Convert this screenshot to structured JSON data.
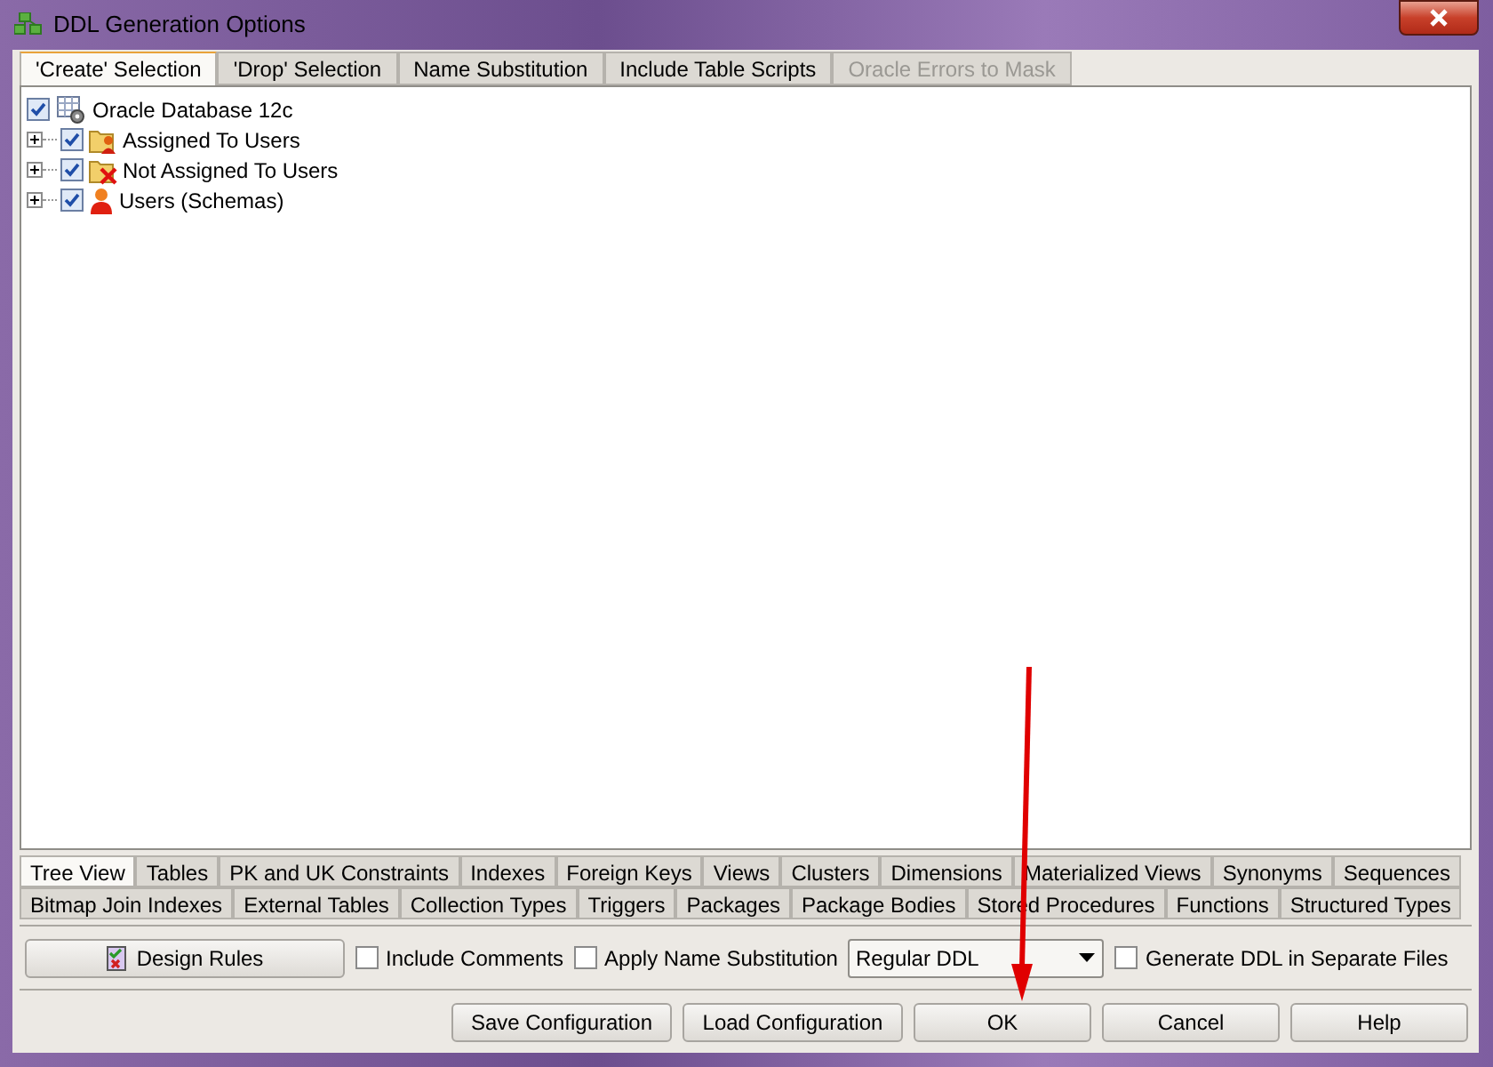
{
  "window": {
    "title": "DDL Generation Options"
  },
  "top_tabs": [
    {
      "label": "'Create' Selection",
      "selected": true,
      "disabled": false
    },
    {
      "label": "'Drop' Selection",
      "selected": false,
      "disabled": false
    },
    {
      "label": "Name Substitution",
      "selected": false,
      "disabled": false
    },
    {
      "label": "Include Table Scripts",
      "selected": false,
      "disabled": false
    },
    {
      "label": "Oracle Errors to Mask",
      "selected": false,
      "disabled": true
    }
  ],
  "tree": {
    "label": "Oracle Database 12c",
    "checked": true,
    "kind": "database",
    "children": [
      {
        "label": "Assigned To Users",
        "checked": true,
        "expanded": false,
        "kind": "user-folder"
      },
      {
        "label": "Not Assigned To Users",
        "checked": true,
        "expanded": false,
        "kind": "excluded-folder"
      },
      {
        "label": "Users (Schemas)",
        "checked": true,
        "expanded": false,
        "kind": "user"
      }
    ]
  },
  "object_tabs": [
    {
      "tabs": [
        {
          "label": "Tree View",
          "selected": true
        },
        {
          "label": "Tables",
          "selected": false
        },
        {
          "label": "PK and UK Constraints",
          "selected": false
        },
        {
          "label": "Indexes",
          "selected": false
        },
        {
          "label": "Foreign Keys",
          "selected": false
        },
        {
          "label": "Views",
          "selected": false
        },
        {
          "label": "Clusters",
          "selected": false
        },
        {
          "label": "Dimensions",
          "selected": false
        },
        {
          "label": "Materialized Views",
          "selected": false
        },
        {
          "label": "Synonyms",
          "selected": false
        },
        {
          "label": "Sequences",
          "selected": false
        }
      ]
    },
    {
      "tabs": [
        {
          "label": "Bitmap Join Indexes",
          "selected": false
        },
        {
          "label": "External Tables",
          "selected": false
        },
        {
          "label": "Collection Types",
          "selected": false
        },
        {
          "label": "Triggers",
          "selected": false
        },
        {
          "label": "Packages",
          "selected": false
        },
        {
          "label": "Package Bodies",
          "selected": false
        },
        {
          "label": "Stored Procedures",
          "selected": false
        },
        {
          "label": "Functions",
          "selected": false
        },
        {
          "label": "Structured Types",
          "selected": false
        }
      ]
    }
  ],
  "options": [
    {
      "kind": "button",
      "label": "Design Rules"
    },
    {
      "kind": "checkbox",
      "label": "Include Comments",
      "checked": false
    },
    {
      "kind": "checkbox",
      "label": "Apply Name Substitution",
      "checked": false
    },
    {
      "kind": "select",
      "value": "Regular DDL"
    },
    {
      "kind": "checkbox",
      "label": "Generate DDL in Separate Files",
      "checked": false
    }
  ],
  "buttons": [
    "Save Configuration",
    "Load Configuration",
    "OK",
    "Cancel",
    "Help"
  ]
}
